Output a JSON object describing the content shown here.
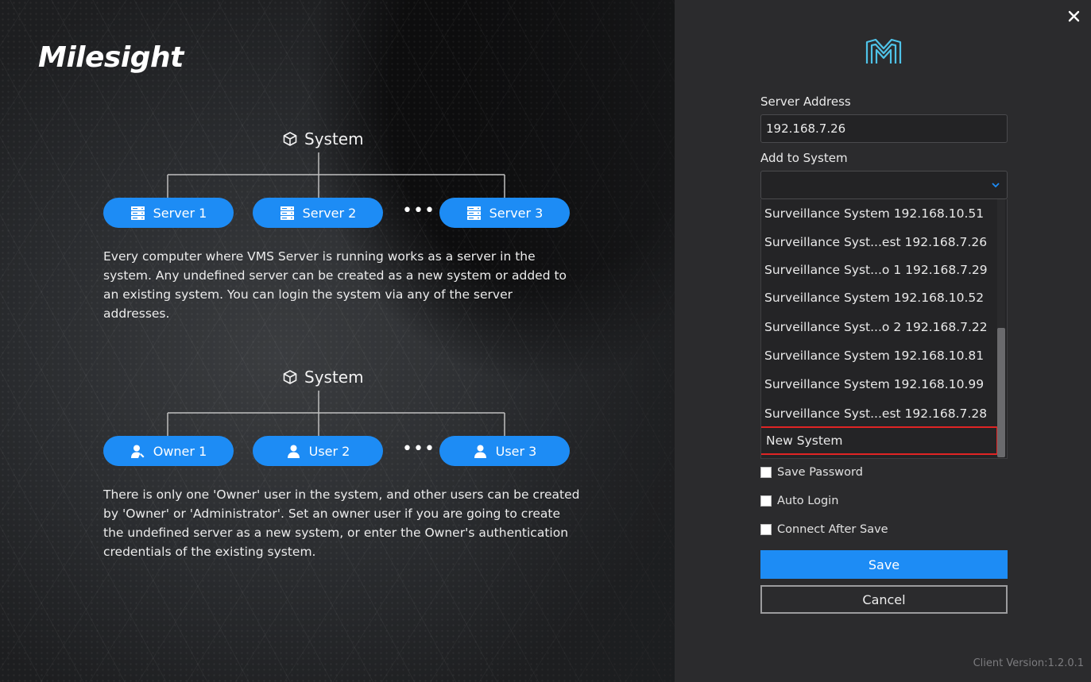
{
  "brand": {
    "logo_text": "Milesight"
  },
  "diagram_servers": {
    "title": "System",
    "nodes": [
      {
        "label": "Server 1",
        "icon": "server-icon"
      },
      {
        "label": "Server 2",
        "icon": "server-icon"
      },
      {
        "label": "Server 3",
        "icon": "server-icon"
      }
    ],
    "ellipsis": "•••",
    "description": "Every computer where VMS Server is running works as a server in the system. Any undefined server can be created as a new system or added to an existing system. You can login the system via any of the server addresses."
  },
  "diagram_users": {
    "title": "System",
    "nodes": [
      {
        "label": "Owner 1",
        "icon": "owner-icon"
      },
      {
        "label": "User 2",
        "icon": "user-icon"
      },
      {
        "label": "User 3",
        "icon": "user-icon"
      }
    ],
    "ellipsis": "•••",
    "description": "There is only one 'Owner' user in the system, and other users can be created by 'Owner' or 'Administrator'. Set an owner user if you are going to create the undefined server as a new system, or enter the Owner's authentication credentials of the existing system."
  },
  "form": {
    "server_address_label": "Server Address",
    "server_address_value": "192.168.7.26",
    "add_to_system_label": "Add to System",
    "add_to_system_value": "",
    "dropdown_options": [
      "Surveillance System 192.168.10.51",
      "Surveillance Syst...est 192.168.7.26",
      "Surveillance Syst...o 1 192.168.7.29",
      "Surveillance System 192.168.10.52",
      "Surveillance Syst...o 2 192.168.7.22",
      "Surveillance System 192.168.10.81",
      "Surveillance System  192.168.10.99",
      "Surveillance Syst...est 192.168.7.28",
      "New System"
    ],
    "highlighted_option": "New System",
    "save_password_label": "Save Password",
    "auto_login_label": "Auto Login",
    "connect_after_save_label": "Connect After Save",
    "save_button": "Save",
    "cancel_button": "Cancel"
  },
  "footer": {
    "version": "Client Version:1.2.0.1"
  },
  "colors": {
    "accent": "#1d8cf5",
    "highlight_border": "#e02424",
    "panel_bg": "#2b2b2d",
    "logo_teal": "#4fc3e8"
  }
}
